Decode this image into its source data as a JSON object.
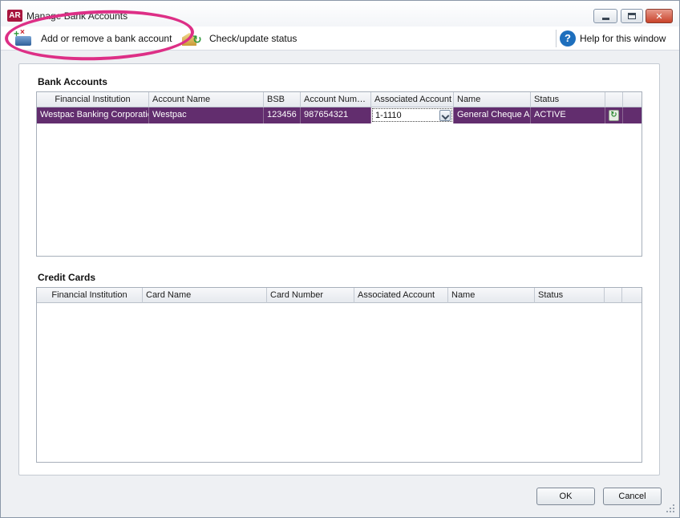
{
  "window": {
    "app_logo": "AR",
    "title": "Manage Bank Accounts"
  },
  "toolbar": {
    "add_remove_label": "Add or remove a bank account",
    "check_status_label": "Check/update status",
    "help_label": "Help for this window",
    "help_glyph": "?"
  },
  "bank_accounts": {
    "title": "Bank Accounts",
    "columns": [
      "Financial Institution",
      "Account Name",
      "BSB",
      "Account Num…",
      "Associated Account",
      "Name",
      "Status",
      "",
      ""
    ],
    "rows": [
      {
        "financial_institution": "Westpac Banking Corporatio",
        "account_name": "Westpac",
        "bsb": "123456",
        "account_number": "987654321",
        "associated_account": "1-1110",
        "name": "General Cheque Ac",
        "status": "ACTIVE",
        "status_icon": "refresh-icon"
      }
    ],
    "selected_row_color": "#622d6e"
  },
  "credit_cards": {
    "title": "Credit Cards",
    "columns": [
      "Financial Institution",
      "Card Name",
      "Card Number",
      "Associated Account",
      "Name",
      "Status",
      "",
      ""
    ],
    "rows": []
  },
  "buttons": {
    "ok": "OK",
    "cancel": "Cancel"
  },
  "colors": {
    "highlight_ring": "#dd2f86",
    "app_logo": "#a8163f"
  }
}
